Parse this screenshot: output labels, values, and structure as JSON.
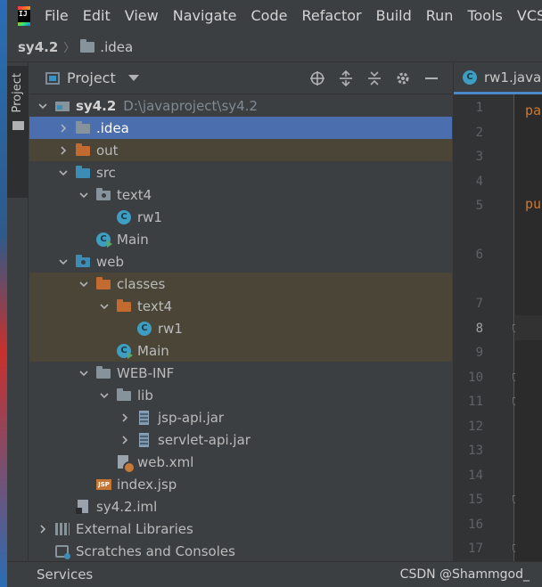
{
  "menubar": {
    "items": [
      "File",
      "Edit",
      "View",
      "Navigate",
      "Code",
      "Refactor",
      "Build",
      "Run",
      "Tools",
      "VCS"
    ]
  },
  "breadcrumb": {
    "root": "sy4.2",
    "child": ".idea"
  },
  "side_strip": {
    "tab_label": "Project"
  },
  "panel": {
    "title": "Project",
    "tools": [
      "locate-icon",
      "expand-all-icon",
      "collapse-all-icon",
      "gear-icon",
      "minimize-icon"
    ]
  },
  "tree": [
    {
      "label": "sy4.2",
      "path": "D:\\javaproject\\sy4.2",
      "depth": 0,
      "arrow": "down",
      "icon": "module-folder-icon"
    },
    {
      "label": ".idea",
      "depth": 1,
      "arrow": "right",
      "icon": "folder-icon",
      "state": "selected"
    },
    {
      "label": "out",
      "depth": 1,
      "arrow": "right",
      "icon": "excluded-folder-icon",
      "state": "excluded"
    },
    {
      "label": "src",
      "depth": 1,
      "arrow": "down",
      "icon": "source-folder-icon"
    },
    {
      "label": "text4",
      "depth": 2,
      "arrow": "down",
      "icon": "package-icon"
    },
    {
      "label": "rw1",
      "depth": 3,
      "arrow": "none",
      "icon": "class-icon"
    },
    {
      "label": "Main",
      "depth": 2,
      "arrow": "none",
      "icon": "runnable-class-icon"
    },
    {
      "label": "web",
      "depth": 1,
      "arrow": "down",
      "icon": "web-folder-icon"
    },
    {
      "label": "classes",
      "depth": 2,
      "arrow": "down",
      "icon": "excluded-folder-icon",
      "state": "excluded"
    },
    {
      "label": "text4",
      "depth": 3,
      "arrow": "down",
      "icon": "excluded-folder-icon",
      "state": "excluded"
    },
    {
      "label": "rw1",
      "depth": 4,
      "arrow": "none",
      "icon": "class-icon",
      "state": "excluded"
    },
    {
      "label": "Main",
      "depth": 3,
      "arrow": "none",
      "icon": "runnable-class-icon",
      "state": "excluded"
    },
    {
      "label": "WEB-INF",
      "depth": 2,
      "arrow": "down",
      "icon": "folder-icon"
    },
    {
      "label": "lib",
      "depth": 3,
      "arrow": "down",
      "icon": "folder-icon"
    },
    {
      "label": "jsp-api.jar",
      "depth": 4,
      "arrow": "right",
      "icon": "jar-icon"
    },
    {
      "label": "servlet-api.jar",
      "depth": 4,
      "arrow": "right",
      "icon": "jar-icon"
    },
    {
      "label": "web.xml",
      "depth": 3,
      "arrow": "none",
      "icon": "xml-icon"
    },
    {
      "label": "index.jsp",
      "depth": 2,
      "arrow": "none",
      "icon": "jsp-icon"
    },
    {
      "label": "sy4.2.iml",
      "depth": 1,
      "arrow": "none",
      "icon": "iml-file-icon"
    },
    {
      "label": "External Libraries",
      "depth": 0,
      "arrow": "right",
      "icon": "libraries-icon"
    },
    {
      "label": "Scratches and Consoles",
      "depth": 0,
      "arrow": "none",
      "icon": "scratches-icon"
    }
  ],
  "editor": {
    "tab_label": "rw1.java",
    "current_line": "8",
    "lines": [
      "1",
      "2",
      "3",
      "4",
      "5",
      "6",
      "7",
      "8",
      "9",
      "10",
      "11",
      "12",
      "13",
      "14",
      "15",
      "16",
      "17"
    ],
    "code_snippets": [
      "pa",
      "pu"
    ]
  },
  "bottom": {
    "services": "Services",
    "watermark": "CSDN @Shammgod_"
  }
}
